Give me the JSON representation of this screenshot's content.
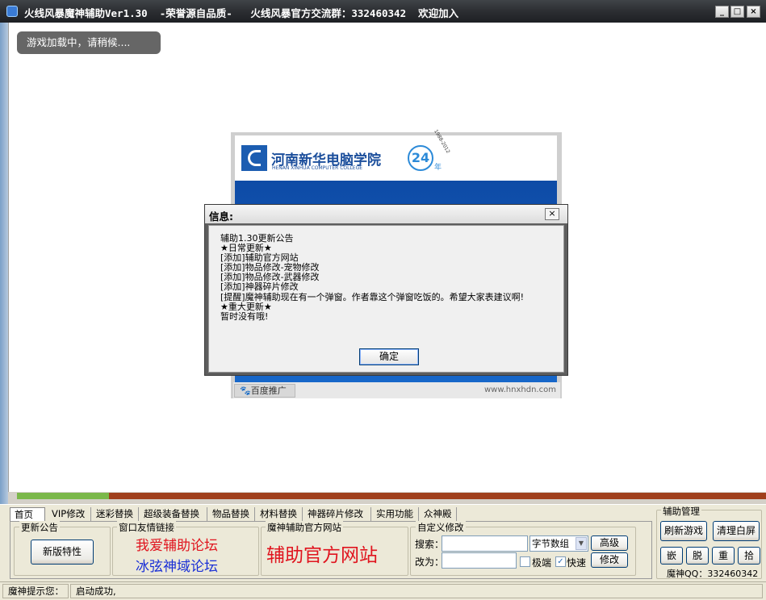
{
  "window": {
    "title": "火线风暴魔神辅助Ver1.30  -荣誉源自品质-   火线风暴官方交流群：332460342  欢迎加入",
    "minimize_label": "_",
    "maximize_label": "□",
    "close_label": "×"
  },
  "game_area": {
    "loading_text": "游戏加载中，请稍候...."
  },
  "ad": {
    "school_name": "河南新华电脑学院",
    "school_name_en": "HENAN XINHUA COMPUTER COLLEGE",
    "anniversary": "24",
    "anniversary_suffix": "年",
    "years": "1988-2012",
    "baidu_label": "🐾百度推广",
    "url": "www.hnxhdn.com"
  },
  "dialog": {
    "title": "信息:",
    "close_label": "×",
    "message": "辅助1.30更新公告\n★日常更新★\n[添加]辅助官方网站\n[添加]物品修改-宠物修改\n[添加]物品修改-武器修改\n[添加]神器碎片修改\n[提醒]魔神辅助现在有一个弹窗。作者靠这个弹窗吃饭的。希望大家表建议啊!\n★重大更新★\n暂时没有哦!",
    "ok_label": "确定"
  },
  "progress": {
    "fraction": 0.123
  },
  "tabs": [
    "首页",
    "VIP修改",
    "迷彩替换",
    "超级装备替换",
    "物品替换",
    "材料替换",
    "神器碎片修改",
    "实用功能",
    "众神殿"
  ],
  "tab_selected": "首页",
  "home": {
    "news_group": "更新公告",
    "new_features_button": "新版特性",
    "links_group": "窗口友情链接",
    "link_1": "我爱辅助论坛",
    "link_2": "冰弦神域论坛",
    "site_group": "魔神辅助官方网站",
    "site_link": "辅助官方网站",
    "custom_group": "自定义修改",
    "search_label": "搜索：",
    "search_value": "",
    "byte_select": "字节数组",
    "advanced_button": "高级",
    "change_label": "改为：",
    "change_value": "",
    "extreme_label": "极端",
    "extreme_checked": false,
    "fast_label": "快速",
    "fast_checked": true,
    "modify_button": "修改"
  },
  "manage": {
    "title": "辅助管理",
    "refresh_button": "刷新游戏",
    "clear_button": "清理白屏",
    "embed_button": "嵌",
    "detach_button": "脱",
    "reload_button": "重",
    "capture_button": "拾",
    "qq_text": "魔神QQ：332460342"
  },
  "status": {
    "label": "魔神提示您：",
    "message": "启动成功,"
  },
  "colors": {
    "link_red": "#e0141e",
    "link_blue": "#1a2fd6",
    "site_red": "#e0141e",
    "progress_green": "#7bb84a",
    "progress_rust": "#a0401c"
  }
}
